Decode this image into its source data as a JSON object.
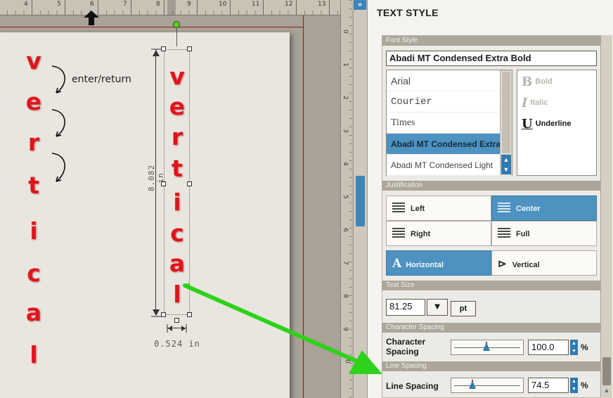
{
  "ruler": {
    "h_ticks": [
      "4",
      "5",
      "6",
      "7",
      "8",
      "9",
      "10",
      "11",
      "12",
      "13"
    ],
    "v_ticks": [
      "0",
      "1",
      "2",
      "3",
      "4",
      "5",
      "6",
      "7",
      "8",
      "9",
      "10"
    ]
  },
  "canvas": {
    "letters_left": [
      "v",
      "e",
      "r",
      "t",
      "i",
      "c",
      "a",
      "l"
    ],
    "letters_selected": [
      "v",
      "e",
      "r",
      "t",
      "i",
      "c",
      "a",
      "l"
    ],
    "annotation": "enter/return",
    "height_label": "8.082 in",
    "width_label": "0.524 in",
    "text_color": "#e2141b",
    "arrow_color": "#2fd21a"
  },
  "panel": {
    "collapse_icon": "»",
    "title": "TEXT STYLE",
    "font_style": {
      "header": "Font Style",
      "current_font": "Abadi MT Condensed Extra Bold",
      "fonts": [
        "Arial",
        "Courier",
        "Times",
        "Abadi MT Condensed Extra",
        "Abadi MT Condensed Light"
      ],
      "selected_index": 3,
      "styles": [
        {
          "glyph": "B",
          "label": "Bold",
          "enabled": false
        },
        {
          "glyph": "I",
          "label": "Italic",
          "enabled": false
        },
        {
          "glyph": "U",
          "label": "Underline",
          "enabled": true
        }
      ]
    },
    "justification": {
      "header": "Justification",
      "left": "Left",
      "center": "Center",
      "right": "Right",
      "full": "Full",
      "horizontal": "Horizontal",
      "vertical": "Vertical",
      "active_alignment": "Center",
      "active_orientation": "Horizontal"
    },
    "text_size": {
      "header": "Text Size",
      "value": "81.25",
      "unit": "pt"
    },
    "char_spacing": {
      "header": "Character Spacing",
      "label_line1": "Character",
      "label_line2": "Spacing",
      "value": "100.0",
      "unit": "%",
      "slider_fraction": 0.5
    },
    "line_spacing": {
      "header": "Line Spacing",
      "label": "Line Spacing",
      "value": "74.5",
      "unit": "%",
      "slider_fraction": 0.28
    },
    "accent": "#4d92c0"
  }
}
